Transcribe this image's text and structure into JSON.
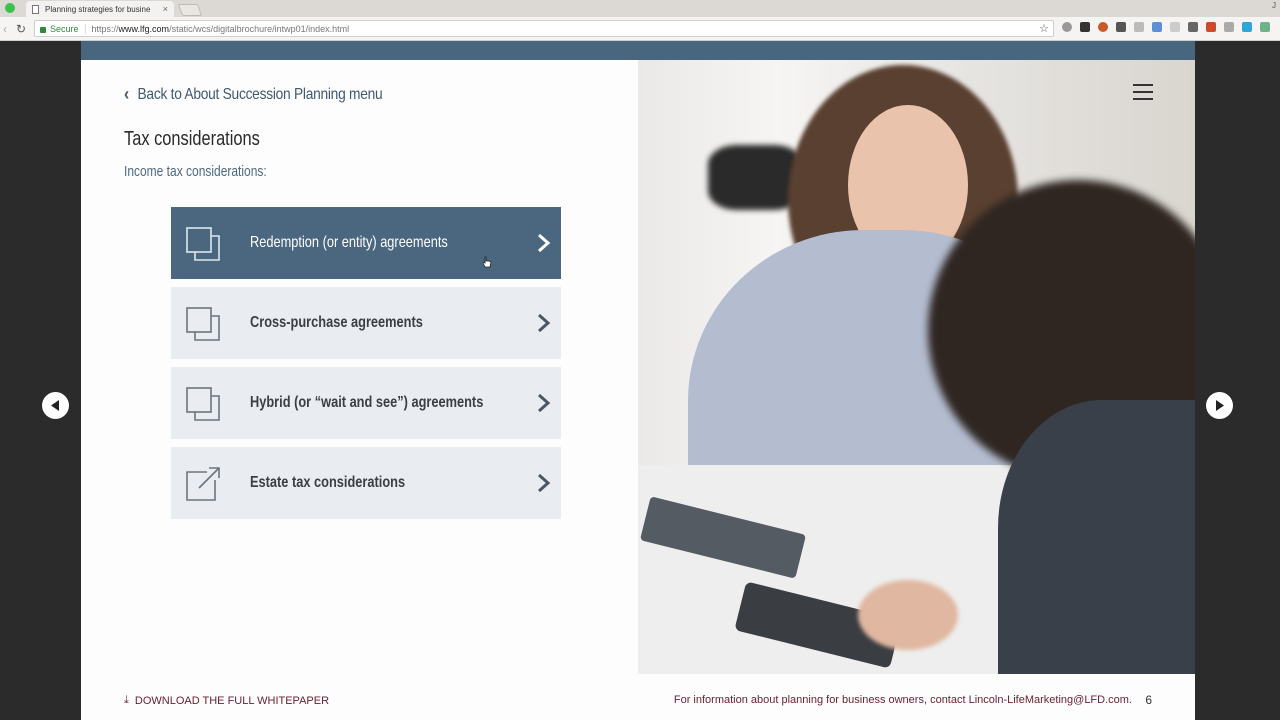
{
  "browser": {
    "tab_title": "Planning strategies for busine",
    "tab_close": "×",
    "secure_label": "Secure",
    "url_scheme": "https://",
    "url_host": "www.lfg.com",
    "url_path": "/static/wcs/digitalbrochure/intwp01/index.html",
    "reload_icon": "↻",
    "back_icon": "‹",
    "star_icon": "☆",
    "profile_initial": "J"
  },
  "page": {
    "back_link": "Back to About Succession Planning menu",
    "back_chevron": "‹",
    "title": "Tax considerations",
    "subtitle": "Income tax considerations:",
    "menu_items": [
      {
        "label": "Redemption (or entity) agreements",
        "icon": "overlapping-squares-icon",
        "active": true
      },
      {
        "label": "Cross-purchase agreements",
        "icon": "overlapping-squares-icon",
        "active": false
      },
      {
        "label": "Hybrid (or “wait and see”) agreements",
        "icon": "overlapping-squares-icon",
        "active": false
      },
      {
        "label": "Estate tax considerations",
        "icon": "external-link-icon",
        "active": false
      }
    ],
    "footer": {
      "download_label": "DOWNLOAD THE FULL WHITEPAPER",
      "download_icon": "⤓",
      "info_text": "For information about planning for business owners, contact Lincoln-LifeMarketing@LFD.com.",
      "page_number": "6"
    }
  },
  "colors": {
    "accent_blue": "#48667e",
    "active_item": "#4a677f",
    "inactive_item": "#e9ecf0",
    "footer_text": "#6a2236"
  }
}
